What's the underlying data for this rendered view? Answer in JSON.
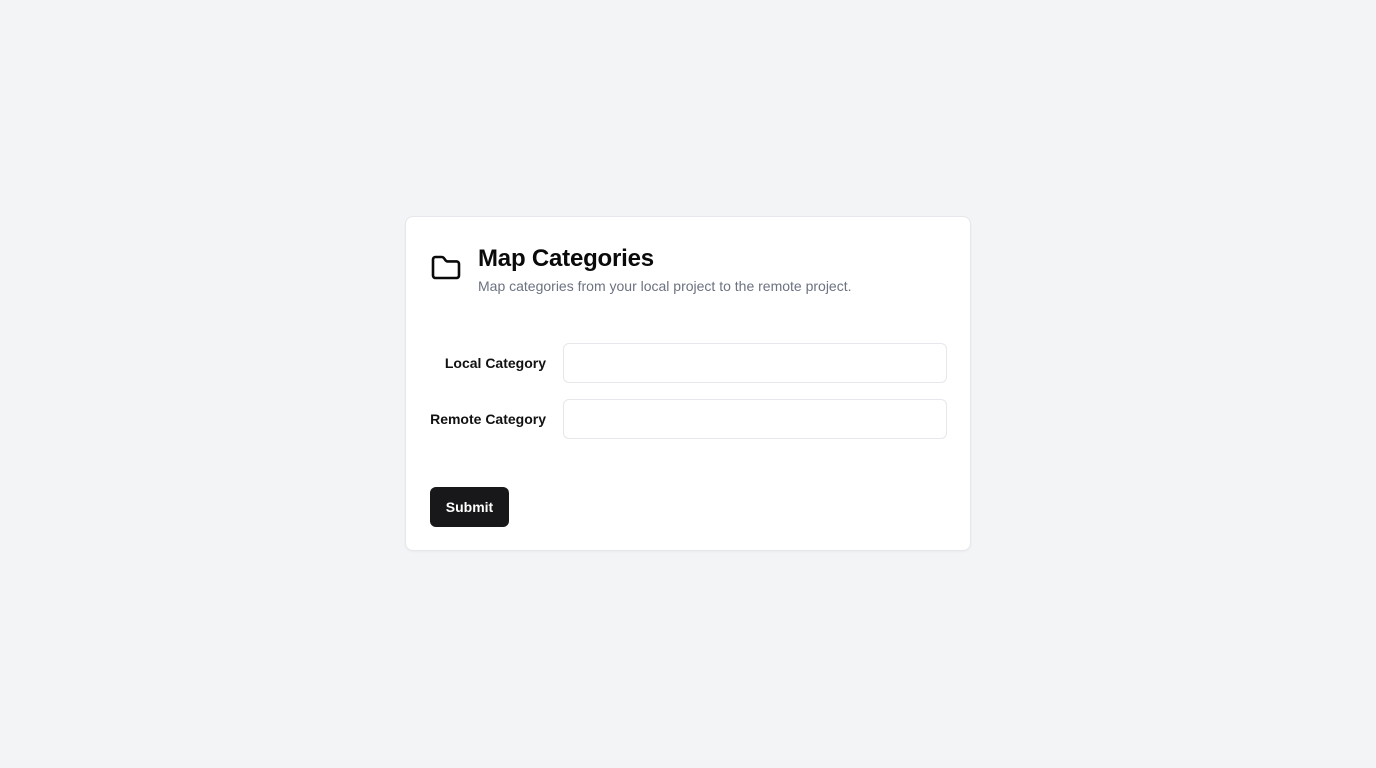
{
  "card": {
    "title": "Map Categories",
    "subtitle": "Map categories from your local project to the remote project.",
    "icon": "folder-icon"
  },
  "form": {
    "local_category": {
      "label": "Local Category",
      "value": "",
      "placeholder": ""
    },
    "remote_category": {
      "label": "Remote Category",
      "value": "",
      "placeholder": ""
    },
    "submit_label": "Submit"
  },
  "colors": {
    "page_background": "#f3f4f6",
    "card_background": "#ffffff",
    "button_background": "#18181b",
    "subtitle_text": "#6b7280"
  }
}
